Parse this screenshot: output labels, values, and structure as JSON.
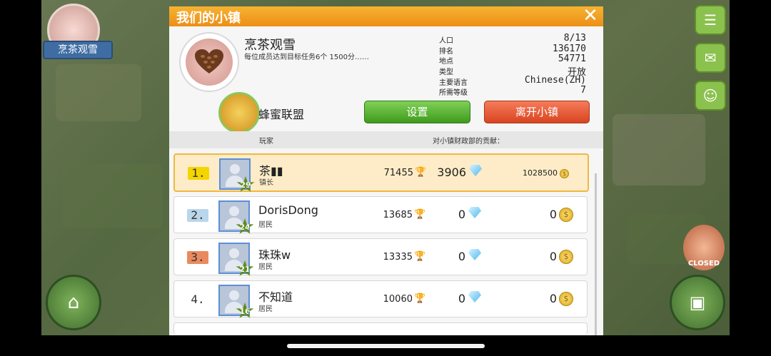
{
  "background": {
    "town_tag": "烹茶观雪",
    "closed_sign": "CLOSED"
  },
  "modal": {
    "title": "我们的小镇",
    "town": {
      "name": "烹茶观雪",
      "description": "每位成员达到目标任务6个   1500分……"
    },
    "stats": [
      {
        "label": "人口",
        "value": "8/13"
      },
      {
        "label": "排名",
        "value": "136170"
      },
      {
        "label": "地点",
        "value": "54771"
      },
      {
        "label": "类型",
        "value": "开放"
      },
      {
        "label": "主要语言",
        "value": "Chinese(ZH)"
      },
      {
        "label": "所需等级",
        "value": "7"
      }
    ],
    "alliance": "蜂蜜联盟",
    "buttons": {
      "settings": "设置",
      "leave": "离开小镇"
    },
    "list_header": {
      "player": "玩家",
      "contribution": "对小镇财政部的贡献："
    },
    "members": [
      {
        "rank": "1.",
        "level": "29",
        "name": "茶▮▮",
        "role": "镇长",
        "trophies": "71455",
        "gems": "3906",
        "coins": "1028500"
      },
      {
        "rank": "2.",
        "level": "24",
        "name": "DorisDong",
        "role": "居民",
        "trophies": "13685",
        "gems": "0",
        "coins": "0"
      },
      {
        "rank": "3.",
        "level": "21",
        "name": "珠珠w",
        "role": "居民",
        "trophies": "13335",
        "gems": "0",
        "coins": "0"
      },
      {
        "rank": "4.",
        "level": "16",
        "name": "不知道",
        "role": "居民",
        "trophies": "10060",
        "gems": "0",
        "coins": "0"
      }
    ]
  },
  "colors": {
    "title_bar": "#ec8f17",
    "settings_button": "#3f9a1c",
    "leave_button": "#d94420",
    "rank1_badge": "#f5d500",
    "rank2_badge": "#b9d6ea",
    "rank3_badge": "#e98a5e",
    "first_row": "#fdecc7"
  },
  "icons": {
    "close": "close-icon",
    "trophy": "trophy-icon",
    "gem": "gem-icon",
    "coin": "coin-icon",
    "level": "star-icon"
  }
}
